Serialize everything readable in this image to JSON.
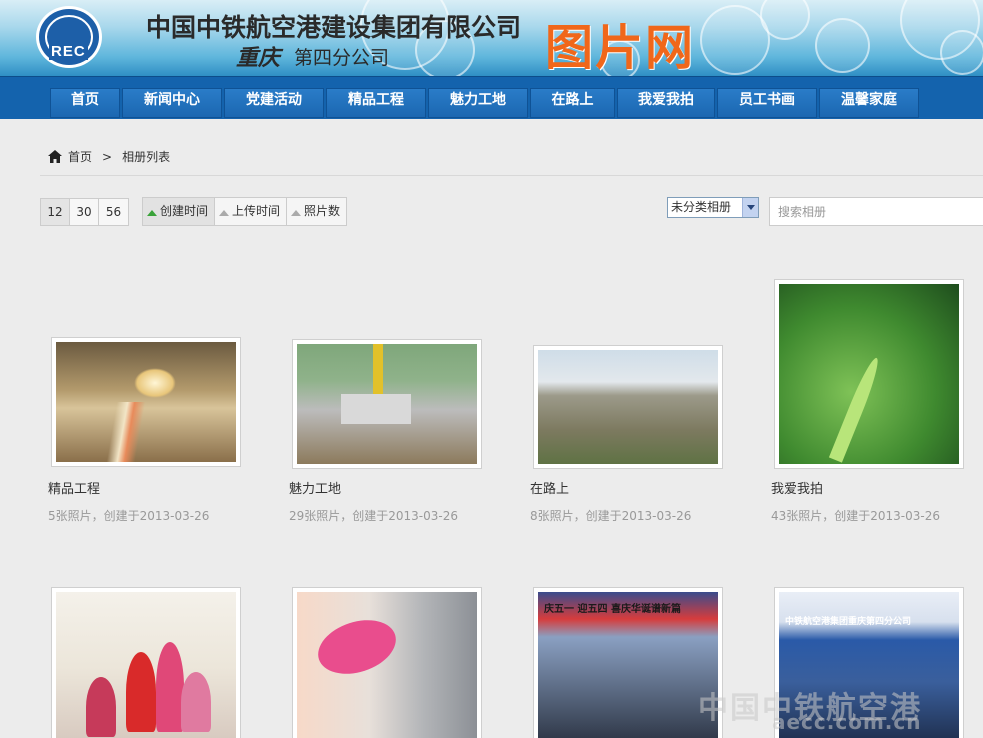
{
  "header": {
    "company_name": "中国中铁航空港建设集团有限公司",
    "branch_script": "重庆",
    "branch_name": "第四分公司",
    "site_name": "图片网",
    "logo_text": "REC"
  },
  "nav": {
    "items": [
      {
        "label": "首页"
      },
      {
        "label": "新闻中心"
      },
      {
        "label": "党建活动"
      },
      {
        "label": "精品工程"
      },
      {
        "label": "魅力工地"
      },
      {
        "label": "在路上"
      },
      {
        "label": "我爱我拍"
      },
      {
        "label": "员工书画"
      },
      {
        "label": "温馨家庭"
      }
    ]
  },
  "breadcrumb": {
    "home": "首页",
    "separator": ">",
    "current": "相册列表"
  },
  "toolbar": {
    "page_sizes": [
      "12",
      "30",
      "56"
    ],
    "sorts": [
      {
        "label": "创建时间",
        "active": true
      },
      {
        "label": "上传时间",
        "active": false
      },
      {
        "label": "照片数",
        "active": false
      }
    ],
    "category_select": "未分类相册",
    "search_placeholder": "搜索相册"
  },
  "albums": [
    {
      "title": "精品工程",
      "meta": "5张照片，创建于2013-03-26",
      "photo": "tunnel"
    },
    {
      "title": "魅力工地",
      "meta": "29张照片，创建于2013-03-26",
      "photo": "site"
    },
    {
      "title": "在路上",
      "meta": "8张照片，创建于2013-03-26",
      "photo": "village"
    },
    {
      "title": "我爱我拍",
      "meta": "43张照片，创建于2013-03-26",
      "photo": "grass"
    },
    {
      "title": "",
      "meta": "",
      "photo": "family"
    },
    {
      "title": "",
      "meta": "",
      "photo": "toy"
    },
    {
      "title": "",
      "meta": "",
      "photo": "team"
    },
    {
      "title": "",
      "meta": "",
      "photo": "meeting"
    }
  ],
  "photo_captions": {
    "team_banner": "庆五一 迎五四 喜庆华诞谱新篇",
    "meeting_banner": "中铁航空港集团重庆第四分公司"
  },
  "watermark": {
    "line1": "中国中铁航空港",
    "line2": "aecc.com.cn"
  }
}
